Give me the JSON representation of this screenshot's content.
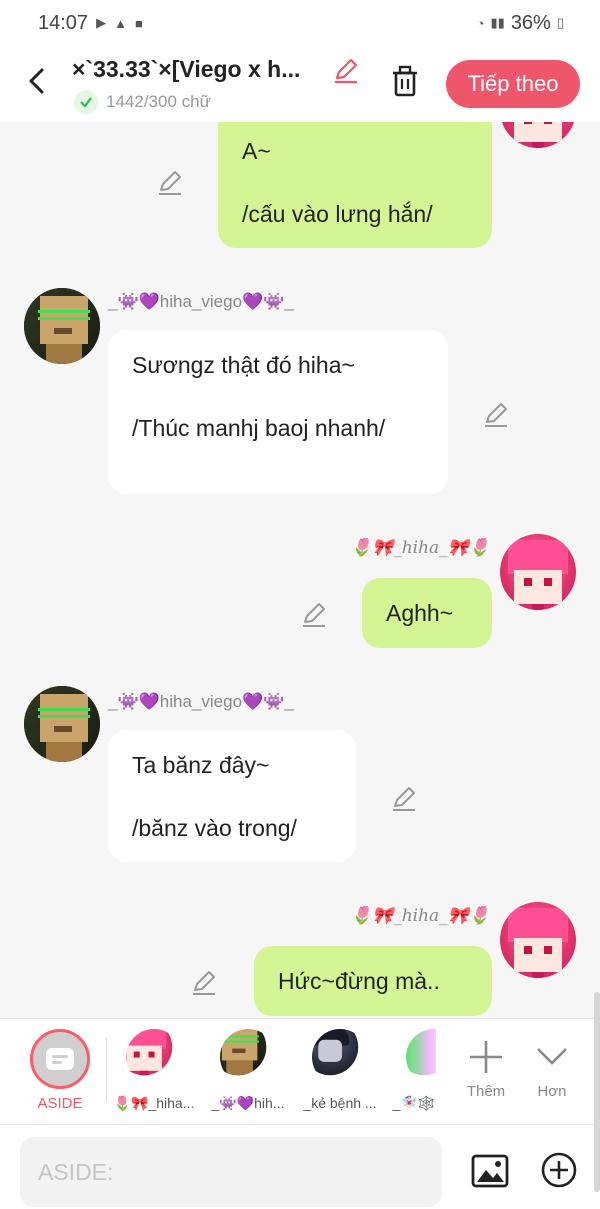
{
  "status_bar": {
    "time": "14:07",
    "battery": "36%"
  },
  "header": {
    "title": "×`33.33`×[Viego x h...",
    "word_count": "1442/300 chữ",
    "next_label": "Tiếp theo"
  },
  "messages": [
    {
      "id": "m1",
      "side": "me",
      "text": "A~\n\n/cấu vào lưng hắn/"
    },
    {
      "id": "m2",
      "side": "other",
      "sender": "_👾💜hiha_viego💜👾_",
      "text": "Sươngz thật đó hiha~\n\n/Thúc manhj baoj nhanh/"
    },
    {
      "id": "m3",
      "side": "me",
      "sender": "🌷🎀_hiha_🎀🌷",
      "text": "Aghh~"
    },
    {
      "id": "m4",
      "side": "other",
      "sender": "_👾💜hiha_viego💜👾_",
      "text": "Ta bănz đây~\n\n/bănz vào trong/"
    },
    {
      "id": "m5",
      "side": "me",
      "sender": "🌷🎀_hiha_🎀🌷",
      "text": "Hức~đừng mà.."
    }
  ],
  "cast_bar": {
    "aside_label": "ASIDE",
    "characters": [
      {
        "label": "🌷🎀_hiha..."
      },
      {
        "label": "_👾💜hih..."
      },
      {
        "label": "_kẻ bệnh ..."
      },
      {
        "label": "_🧚🏻‍♀️🕸️"
      }
    ],
    "more_label": "Thêm",
    "less_label": "Hơn"
  },
  "composer": {
    "placeholder": "ASIDE:"
  },
  "colors": {
    "accent": "#f0566b",
    "my_bubble": "#d3f594",
    "other_bubble": "#ffffff",
    "background": "#f6f6f6"
  }
}
